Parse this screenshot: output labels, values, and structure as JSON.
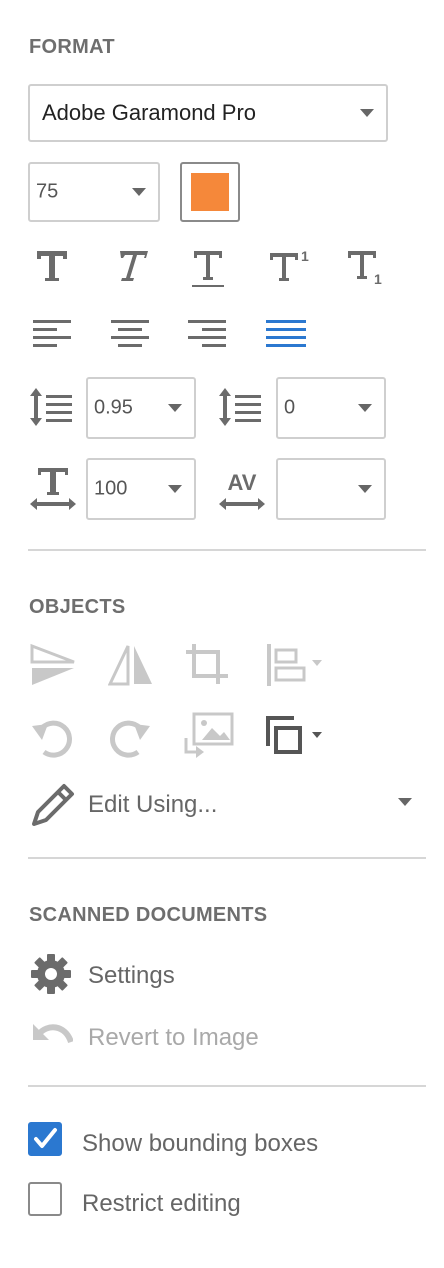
{
  "format": {
    "title": "FORMAT",
    "font_family": "Adobe Garamond Pro",
    "font_size": "75",
    "color_swatch": "#f5883a",
    "text_styles": [
      "bold-t-icon",
      "italic-t-icon",
      "underline-t-icon",
      "superscript-icon",
      "subscript-icon"
    ],
    "superscript_digit": "1",
    "subscript_digit": "1",
    "alignments": [
      "align-left",
      "align-center",
      "align-right",
      "justify"
    ],
    "active_alignment": "justify",
    "accent_color": "#2b78d0",
    "line_spacing": "0.95",
    "paragraph_spacing": "0",
    "horizontal_scaling": "100",
    "character_spacing": "",
    "kerning_glyph": "AV"
  },
  "objects": {
    "title": "OBJECTS",
    "edit_using_label": "Edit Using..."
  },
  "scanned": {
    "title": "SCANNED DOCUMENTS",
    "settings_label": "Settings",
    "revert_label": "Revert to Image"
  },
  "options": {
    "show_bounding_boxes_label": "Show bounding boxes",
    "show_bounding_boxes_checked": true,
    "restrict_editing_label": "Restrict editing",
    "restrict_editing_checked": false
  }
}
